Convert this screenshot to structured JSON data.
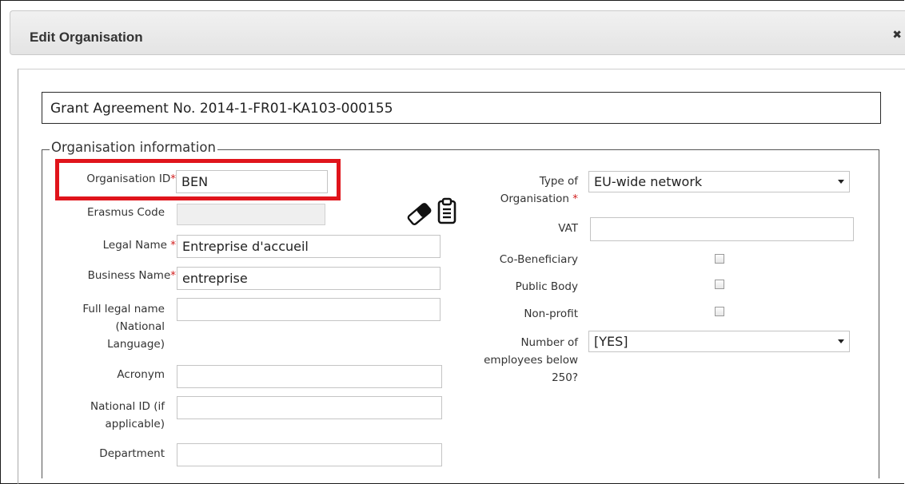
{
  "dialog": {
    "title": "Edit Organisation",
    "close_glyph": "✖"
  },
  "grant": {
    "text": "Grant Agreement No. 2014-1-FR01-KA103-000155"
  },
  "section": {
    "legend": "Organisation information"
  },
  "left": {
    "org_id": {
      "label": "Organisation ID",
      "required": "*",
      "value": "BEN"
    },
    "erasmus_code": {
      "label": "Erasmus Code",
      "value": ""
    },
    "legal_name": {
      "label": "Legal Name",
      "required": "*",
      "value": "Entreprise d'accueil"
    },
    "business_name": {
      "label": "Business Name",
      "required": "*",
      "value": "entreprise"
    },
    "full_legal_name": {
      "label_line1": "Full legal name",
      "label_line2": "(National",
      "label_line3": "Language)",
      "value": ""
    },
    "acronym": {
      "label": "Acronym",
      "value": ""
    },
    "national_id": {
      "label_line1": "National ID (if",
      "label_line2": "applicable)",
      "value": ""
    },
    "department": {
      "label": "Department",
      "value": ""
    }
  },
  "right": {
    "type_of_org": {
      "label_line1": "Type of",
      "label_line2": "Organisation",
      "required": "*",
      "value": "EU-wide network"
    },
    "vat": {
      "label": "VAT",
      "value": ""
    },
    "co_beneficiary": {
      "label": "Co-Beneficiary",
      "checked": false
    },
    "public_body": {
      "label": "Public Body",
      "checked": false
    },
    "non_profit": {
      "label": "Non-profit",
      "checked": false
    },
    "employees": {
      "label_line1": "Number of",
      "label_line2": "employees below",
      "label_line3": "250?",
      "value": "[YES]"
    }
  },
  "icons": {
    "eraser": "eraser-icon",
    "clipboard": "clipboard-icon",
    "close": "close-icon",
    "dropdown": "chevron-down-icon"
  },
  "colors": {
    "highlight": "#e0141b",
    "required": "#d21f1f",
    "header_bg": "#ebebeb"
  }
}
